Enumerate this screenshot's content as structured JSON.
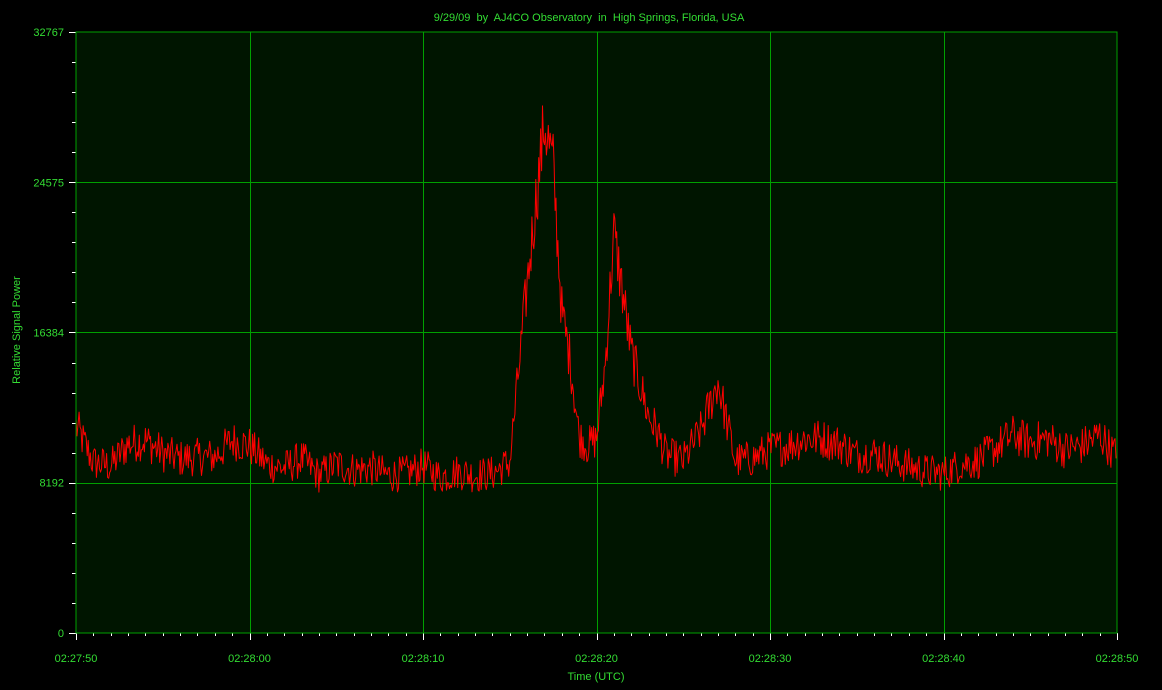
{
  "chart_data": {
    "type": "line",
    "title": "9/29/09  by  AJ4CO Observatory  in  High Springs, Florida, USA",
    "xlabel": "Time (UTC)",
    "ylabel": "Relative Signal Power",
    "x_ticks": [
      "02:27:50",
      "02:28:00",
      "02:28:10",
      "02:28:20",
      "02:28:30",
      "02:28:40",
      "02:28:50"
    ],
    "x_tick_seconds": [
      0,
      10,
      20,
      30,
      40,
      50,
      60
    ],
    "xlim_seconds": [
      0,
      60
    ],
    "y_ticks": [
      "0",
      "8192",
      "16384",
      "24575",
      "32767"
    ],
    "y_tick_values": [
      0,
      8192,
      16384,
      24575,
      32767
    ],
    "ylim": [
      0,
      32767
    ],
    "grid": true,
    "series": [
      {
        "x_seconds": [
          0,
          1,
          2,
          3,
          4,
          5,
          6,
          7,
          8,
          9,
          10,
          11,
          12,
          13,
          14,
          15,
          16,
          17,
          18,
          19,
          20,
          21,
          22,
          23,
          24,
          25,
          26,
          26.5,
          27,
          27.5,
          28,
          28.5,
          29,
          29.5,
          30,
          30.5,
          31,
          31.5,
          32,
          32.5,
          33,
          33.5,
          34,
          35,
          36,
          37,
          38,
          39,
          40,
          41,
          42,
          43,
          44,
          45,
          46,
          47,
          48,
          49,
          50,
          51,
          52,
          53,
          54,
          55,
          56,
          57,
          58,
          59,
          60
        ],
        "values": [
          11300,
          9300,
          9100,
          10300,
          10500,
          9800,
          9500,
          9600,
          9600,
          10500,
          10200,
          9200,
          9000,
          9500,
          8600,
          9200,
          8900,
          9000,
          8600,
          8700,
          9100,
          8500,
          8800,
          8600,
          8700,
          9300,
          19000,
          23500,
          27800,
          25500,
          17500,
          14800,
          10700,
          10200,
          10600,
          14600,
          21800,
          18600,
          15300,
          13600,
          11800,
          11000,
          9700,
          9400,
          11000,
          13700,
          9400,
          9500,
          10000,
          10200,
          10600,
          10600,
          10300,
          9700,
          9800,
          9400,
          9100,
          8800,
          8700,
          9200,
          9400,
          10100,
          10800,
          10400,
          10600,
          10000,
          10200,
          10800,
          9600,
          10600,
          9200
        ],
        "color": "#ff0000"
      }
    ],
    "colors": {
      "background": "#000000",
      "plot_background": "#001500",
      "grid": "#00a000",
      "text": "#33dd33",
      "series": "#ff0000"
    }
  }
}
